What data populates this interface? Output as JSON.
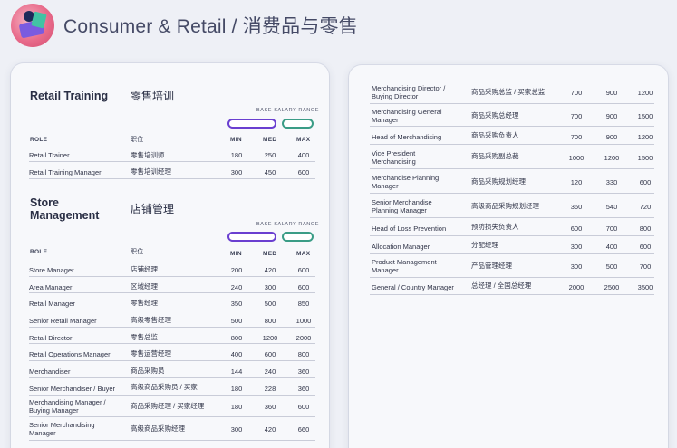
{
  "header": {
    "title": "Consumer & Retail / 消费品与零售"
  },
  "retail_training": {
    "title_en": "Retail Training",
    "title_zh": "零售培训",
    "range_label": "BASE SALARY RANGE",
    "col_role": "ROLE",
    "col_zh": "职位",
    "col_min": "MIN",
    "col_med": "MED",
    "col_max": "MAX",
    "rows": [
      {
        "role": "Retail Trainer",
        "zh": "零售培训师",
        "min": "180",
        "med": "250",
        "max": "400"
      },
      {
        "role": "Retail Training Manager",
        "zh": "零售培训经理",
        "min": "300",
        "med": "450",
        "max": "600"
      }
    ]
  },
  "store_management": {
    "title_en": "Store Management",
    "title_zh": "店铺管理",
    "range_label": "BASE SALARY RANGE",
    "col_role": "ROLE",
    "col_zh": "职位",
    "col_min": "MIN",
    "col_med": "MED",
    "col_max": "MAX",
    "rows": [
      {
        "role": "Store Manager",
        "zh": "店铺经理",
        "min": "200",
        "med": "420",
        "max": "600"
      },
      {
        "role": "Area Manager",
        "zh": "区域经理",
        "min": "240",
        "med": "300",
        "max": "600"
      },
      {
        "role": "Retail Manager",
        "zh": "零售经理",
        "min": "350",
        "med": "500",
        "max": "850"
      },
      {
        "role": "Senior Retail Manager",
        "zh": "高级零售经理",
        "min": "500",
        "med": "800",
        "max": "1000"
      },
      {
        "role": "Retail Director",
        "zh": "零售总监",
        "min": "800",
        "med": "1200",
        "max": "2000"
      },
      {
        "role": "Retail Operations Manager",
        "zh": "零售运营经理",
        "min": "400",
        "med": "600",
        "max": "800"
      },
      {
        "role": "Merchandiser",
        "zh": "商品采购员",
        "min": "144",
        "med": "240",
        "max": "360"
      },
      {
        "role": "Senior Merchandiser / Buyer",
        "zh": "高级商品采购员 / 买家",
        "min": "180",
        "med": "228",
        "max": "360"
      },
      {
        "role": "Merchandising Manager / Buying Manager",
        "zh": "商品采购经理 / 买家经理",
        "min": "180",
        "med": "360",
        "max": "600"
      },
      {
        "role": "Senior Merchandising Manager",
        "zh": "高级商品采购经理",
        "min": "300",
        "med": "420",
        "max": "660"
      }
    ]
  },
  "right_table": {
    "rows": [
      {
        "role": "Merchandising Director / Buying Director",
        "zh": "商品采购总监 / 买家总监",
        "min": "700",
        "med": "900",
        "max": "1200"
      },
      {
        "role": "Merchandising General Manager",
        "zh": "商品采购总经理",
        "min": "700",
        "med": "900",
        "max": "1500"
      },
      {
        "role": "Head of Merchandising",
        "zh": "商品采购负责人",
        "min": "700",
        "med": "900",
        "max": "1200"
      },
      {
        "role": "Vice President Merchandising",
        "zh": "商品采购副总裁",
        "min": "1000",
        "med": "1200",
        "max": "1500"
      },
      {
        "role": "Merchandise Planning Manager",
        "zh": "商品采购规划经理",
        "min": "120",
        "med": "330",
        "max": "600"
      },
      {
        "role": "Senior Merchandise Planning Manager",
        "zh": "高级商品采购规划经理",
        "min": "360",
        "med": "540",
        "max": "720"
      },
      {
        "role": "Head of Loss Prevention",
        "zh": "预防损失负责人",
        "min": "600",
        "med": "700",
        "max": "800"
      },
      {
        "role": "Allocation Manager",
        "zh": "分配经理",
        "min": "300",
        "med": "400",
        "max": "600"
      },
      {
        "role": "Product Management Manager",
        "zh": "产品管理经理",
        "min": "300",
        "med": "500",
        "max": "700"
      },
      {
        "role": "General / Country Manager",
        "zh": "总经理 / 全国总经理",
        "min": "2000",
        "med": "2500",
        "max": "3500"
      }
    ]
  },
  "colors": {
    "pill_purple": "#6a3fd0",
    "pill_teal": "#3a9c86",
    "logo_pink": "#e86a8a"
  },
  "icons": {
    "logo": "shopping-cart-figure-logo"
  }
}
